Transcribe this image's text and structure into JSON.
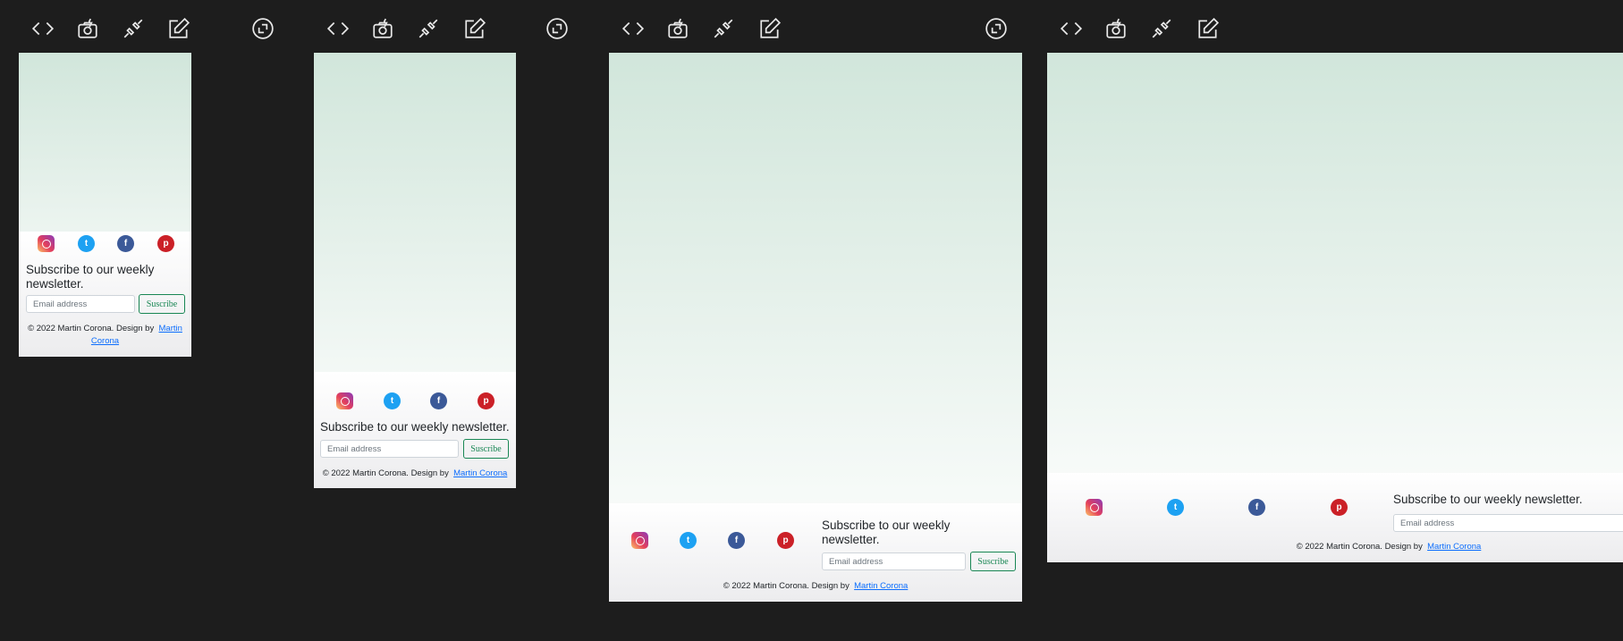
{
  "toolbar": {
    "icons": [
      "code-icon",
      "camera-icon",
      "plug-icon",
      "edit-icon",
      "resize-icon"
    ]
  },
  "site": {
    "social": [
      "instagram",
      "twitter",
      "facebook",
      "pinterest"
    ],
    "newsletter_heading": "Subscribe to our weekly newsletter.",
    "newsletter_heading_wrap_1": "Subscribe to our weekly",
    "newsletter_heading_wrap_2": "newsletter.",
    "email_placeholder": "Email address",
    "subscribe_label": "Suscribe",
    "copyright": "© 2022 Martin Corona. Design by",
    "designer_link": "Martin Corona",
    "designer_wrap_1": "Martin",
    "designer_wrap_2": "Corona"
  },
  "colors": {
    "bg": "#1d1d1d",
    "gradient_top": "#d1e6db",
    "accent": "#198754",
    "link": "#0d6efd",
    "instagram": "#e33e5c",
    "twitter": "#1da1f2",
    "facebook": "#3b5998",
    "pinterest": "#cb2027"
  }
}
